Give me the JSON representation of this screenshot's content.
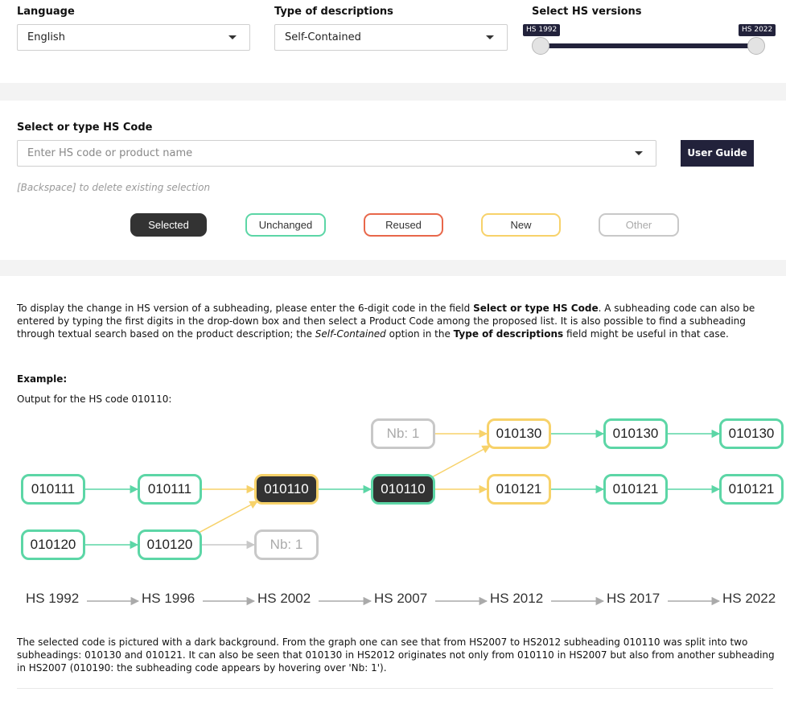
{
  "filters": {
    "language": {
      "label": "Language",
      "value": "English"
    },
    "descriptions": {
      "label": "Type of descriptions",
      "value": "Self-Contained"
    },
    "hs_versions": {
      "label": "Select HS versions",
      "min_label": "HS 1992",
      "max_label": "HS 2022"
    }
  },
  "search": {
    "label": "Select or type HS Code",
    "placeholder": "Enter HS code or product name",
    "hint": "[Backspace] to delete existing selection",
    "user_guide_label": "User Guide"
  },
  "legend": [
    {
      "label": "Selected",
      "color": "#333333",
      "text_color": "#ffffff"
    },
    {
      "label": "Unchanged",
      "color": "#5cd6a6",
      "text_color": "#333333"
    },
    {
      "label": "Reused",
      "color": "#e8674a",
      "text_color": "#333333"
    },
    {
      "label": "New",
      "color": "#f7d26a",
      "text_color": "#333333"
    },
    {
      "label": "Other",
      "color": "#c8c8c8",
      "text_color": "#aaaaaa"
    }
  ],
  "help": {
    "intro_1": "To display the change in HS version of a subheading, please enter the 6-digit code in the field ",
    "intro_b1": "Select or type HS Code",
    "intro_2": ". A subheading code can also be entered by typing the first digits in the drop-down box and then select a Product Code among the proposed list. It is also possible to find a subheading through textual search based on the product description; the ",
    "intro_i1": "Self-Contained",
    "intro_3": " option in the ",
    "intro_b2": "Type of descriptions",
    "intro_4": " field might be useful in that case.",
    "example_title": "Example:",
    "example_caption": "Output for the HS code 010110:",
    "explanation": "The selected code is pictured with a dark background. From the graph one can see that from HS2007 to HS2012 subheading 010110 was split into two subheadings: 010130 and 010121. It can also be seen that 010130 in HS2012 originates not only from 010110 in HS2007 but also from another subheading in HS2007 (010190: the subheading code appears by hovering over 'Nb: 1')."
  },
  "example_graph": {
    "versions": [
      "HS 1992",
      "HS 1996",
      "HS 2002",
      "HS 2007",
      "HS 2012",
      "HS 2017",
      "HS 2022"
    ],
    "nodes": [
      {
        "id": "a1",
        "label": "010111",
        "col": 0,
        "row": 1,
        "status": "Unchanged"
      },
      {
        "id": "a2",
        "label": "010120",
        "col": 0,
        "row": 2,
        "status": "Unchanged"
      },
      {
        "id": "b1",
        "label": "010111",
        "col": 1,
        "row": 1,
        "status": "Unchanged"
      },
      {
        "id": "b2",
        "label": "010120",
        "col": 1,
        "row": 2,
        "status": "Unchanged"
      },
      {
        "id": "c1",
        "label": "010110",
        "col": 2,
        "row": 1,
        "status": "Selected-New"
      },
      {
        "id": "c2",
        "label": "Nb: 1",
        "col": 2,
        "row": 2,
        "status": "Other"
      },
      {
        "id": "d0",
        "label": "Nb: 1",
        "col": 3,
        "row": 0,
        "status": "Other"
      },
      {
        "id": "d1",
        "label": "010110",
        "col": 3,
        "row": 1,
        "status": "Selected-Unchanged"
      },
      {
        "id": "e0",
        "label": "010130",
        "col": 4,
        "row": 0,
        "status": "New"
      },
      {
        "id": "e1",
        "label": "010121",
        "col": 4,
        "row": 1,
        "status": "New"
      },
      {
        "id": "f0",
        "label": "010130",
        "col": 5,
        "row": 0,
        "status": "Unchanged"
      },
      {
        "id": "f1",
        "label": "010121",
        "col": 5,
        "row": 1,
        "status": "Unchanged"
      },
      {
        "id": "g0",
        "label": "010130",
        "col": 6,
        "row": 0,
        "status": "Unchanged"
      },
      {
        "id": "g1",
        "label": "010121",
        "col": 6,
        "row": 1,
        "status": "Unchanged"
      }
    ],
    "edges": [
      {
        "from": "a1",
        "to": "b1",
        "color": "#5cd6a6"
      },
      {
        "from": "a2",
        "to": "b2",
        "color": "#5cd6a6"
      },
      {
        "from": "b1",
        "to": "c1",
        "color": "#f7d26a"
      },
      {
        "from": "b2",
        "to": "c1",
        "color": "#f7d26a"
      },
      {
        "from": "b2",
        "to": "c2",
        "color": "#c8c8c8"
      },
      {
        "from": "c1",
        "to": "d1",
        "color": "#5cd6a6"
      },
      {
        "from": "d0",
        "to": "e0",
        "color": "#f7d26a"
      },
      {
        "from": "d1",
        "to": "e0",
        "color": "#f7d26a"
      },
      {
        "from": "d1",
        "to": "e1",
        "color": "#f7d26a"
      },
      {
        "from": "e0",
        "to": "f0",
        "color": "#5cd6a6"
      },
      {
        "from": "e1",
        "to": "f1",
        "color": "#5cd6a6"
      },
      {
        "from": "f0",
        "to": "g0",
        "color": "#5cd6a6"
      },
      {
        "from": "f1",
        "to": "g1",
        "color": "#5cd6a6"
      }
    ]
  }
}
